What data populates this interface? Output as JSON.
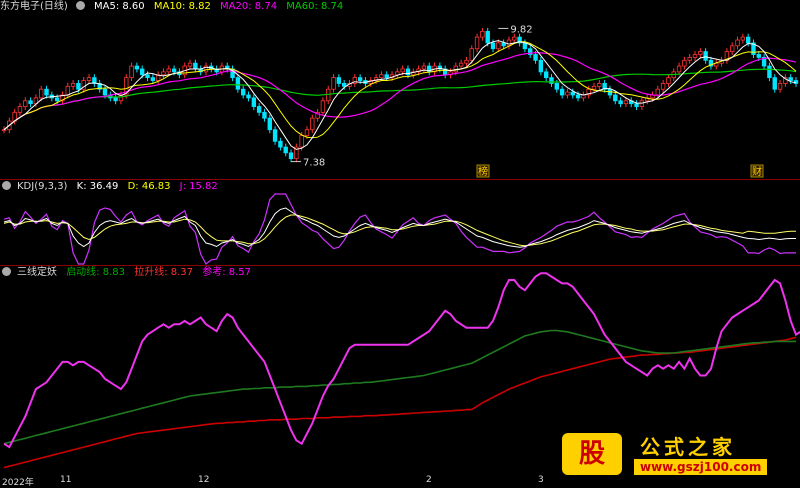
{
  "main": {
    "title": "东方电子(日线)",
    "ma": [
      {
        "label": "MA5: 8.60",
        "color": "#ffffff"
      },
      {
        "label": "MA10: 8.82",
        "color": "#ffff00"
      },
      {
        "label": "MA20: 8.74",
        "color": "#ff00ff"
      },
      {
        "label": "MA60: 8.74",
        "color": "#00cc00"
      }
    ],
    "high_label": "9.82",
    "low_label": "7.38",
    "marker_left": "榜",
    "marker_right": "财"
  },
  "kdj": {
    "title": "KDJ(9,3,3)",
    "items": [
      {
        "label": "K: 36.49",
        "color": "#ffffff"
      },
      {
        "label": "D: 46.83",
        "color": "#ffff00"
      },
      {
        "label": "J: 15.82",
        "color": "#ff00ff"
      }
    ]
  },
  "sanxian": {
    "title": "三线定妖",
    "items": [
      {
        "label": "启动线: 8.83",
        "color": "#00aa00"
      },
      {
        "label": "拉升线: 8.37",
        "color": "#ff3333"
      },
      {
        "label": "参考: 8.57",
        "color": "#ff00ff"
      }
    ]
  },
  "xaxis": {
    "labels": [
      "2022年",
      "11",
      "12",
      "2",
      "3"
    ]
  },
  "watermark": {
    "logo": "股",
    "title": "公式之家",
    "url": "www.gszj100.com"
  },
  "chart_data": {
    "type": "line",
    "n_bars": 150,
    "price": {
      "ylim": [
        7.2,
        10.0
      ],
      "close": [
        8.0,
        8.15,
        8.3,
        8.4,
        8.5,
        8.45,
        8.55,
        8.7,
        8.6,
        8.55,
        8.5,
        8.6,
        8.75,
        8.8,
        8.7,
        8.85,
        8.9,
        8.8,
        8.7,
        8.6,
        8.55,
        8.5,
        8.6,
        8.9,
        9.1,
        9.05,
        8.95,
        8.9,
        8.85,
        8.95,
        9.0,
        9.05,
        9.0,
        8.95,
        9.1,
        9.15,
        9.05,
        9.0,
        9.1,
        9.05,
        9.0,
        9.1,
        9.05,
        8.9,
        8.7,
        8.6,
        8.55,
        8.4,
        8.3,
        8.2,
        8.0,
        7.8,
        7.7,
        7.6,
        7.5,
        7.7,
        7.9,
        8.0,
        8.2,
        8.3,
        8.5,
        8.7,
        8.9,
        8.8,
        8.75,
        8.8,
        8.9,
        8.85,
        8.8,
        8.85,
        8.9,
        8.95,
        8.9,
        8.95,
        9.0,
        9.05,
        8.95,
        9.0,
        9.05,
        9.1,
        9.0,
        9.1,
        9.05,
        8.95,
        9.0,
        9.1,
        9.15,
        9.2,
        9.4,
        9.6,
        9.7,
        9.5,
        9.4,
        9.5,
        9.45,
        9.55,
        9.6,
        9.5,
        9.4,
        9.3,
        9.2,
        9.0,
        8.9,
        8.8,
        8.7,
        8.6,
        8.65,
        8.6,
        8.55,
        8.6,
        8.7,
        8.75,
        8.8,
        8.7,
        8.6,
        8.5,
        8.45,
        8.5,
        8.45,
        8.4,
        8.5,
        8.55,
        8.6,
        8.7,
        8.8,
        8.9,
        9.0,
        9.1,
        9.2,
        9.25,
        9.3,
        9.35,
        9.2,
        9.1,
        9.15,
        9.2,
        9.35,
        9.45,
        9.55,
        9.6,
        9.5,
        9.3,
        9.25,
        9.1,
        8.9,
        8.7,
        8.8,
        8.9,
        8.85,
        8.8
      ],
      "ma_note": "MA lines computed from closes",
      "high": {
        "index": 93,
        "value": 9.82
      },
      "low": {
        "index": 54,
        "value": 7.38
      }
    },
    "kdj": {
      "ylim": [
        0,
        100
      ],
      "K": [
        60,
        62,
        55,
        58,
        65,
        63,
        60,
        62,
        65,
        58,
        55,
        60,
        58,
        40,
        30,
        25,
        30,
        45,
        55,
        60,
        62,
        60,
        58,
        62,
        65,
        60,
        58,
        60,
        62,
        64,
        60,
        58,
        62,
        65,
        68,
        60,
        55,
        40,
        30,
        28,
        25,
        30,
        32,
        35,
        30,
        28,
        25,
        30,
        35,
        45,
        60,
        72,
        78,
        80,
        75,
        70,
        65,
        62,
        58,
        55,
        50,
        45,
        40,
        38,
        40,
        45,
        50,
        55,
        58,
        55,
        52,
        50,
        48,
        45,
        48,
        52,
        55,
        58,
        56,
        55,
        58,
        60,
        62,
        64,
        62,
        60,
        55,
        50,
        45,
        40,
        38,
        35,
        32,
        30,
        28,
        26,
        25,
        24,
        25,
        28,
        30,
        32,
        35,
        38,
        42,
        45,
        48,
        50,
        52,
        55,
        58,
        62,
        60,
        58,
        55,
        52,
        50,
        48,
        46,
        45,
        44,
        46,
        48,
        50,
        52,
        55,
        58,
        60,
        62,
        58,
        55,
        52,
        50,
        48,
        46,
        45,
        44,
        42,
        40,
        38,
        36.49,
        36,
        35,
        36,
        37,
        36,
        35,
        36,
        36.49,
        36.49
      ],
      "D": [
        58,
        60,
        57,
        57,
        60,
        61,
        61,
        61,
        62,
        60,
        58,
        59,
        58,
        52,
        45,
        38,
        35,
        38,
        44,
        50,
        54,
        56,
        57,
        58,
        60,
        60,
        59,
        59,
        60,
        61,
        61,
        60,
        60,
        62,
        64,
        63,
        60,
        53,
        45,
        39,
        34,
        33,
        33,
        33,
        32,
        31,
        29,
        29,
        31,
        36,
        44,
        53,
        61,
        67,
        70,
        70,
        68,
        66,
        63,
        60,
        57,
        53,
        49,
        45,
        43,
        44,
        46,
        49,
        52,
        53,
        53,
        52,
        51,
        49,
        49,
        50,
        52,
        54,
        55,
        55,
        56,
        57,
        59,
        61,
        61,
        61,
        59,
        56,
        52,
        48,
        45,
        42,
        39,
        36,
        33,
        31,
        29,
        27,
        26,
        27,
        28,
        29,
        31,
        33,
        36,
        39,
        42,
        45,
        47,
        50,
        53,
        56,
        57,
        57,
        56,
        55,
        53,
        51,
        50,
        48,
        47,
        47,
        47,
        48,
        49,
        51,
        53,
        55,
        57,
        57,
        56,
        55,
        53,
        51,
        50,
        48,
        47,
        46,
        45,
        44,
        46.83,
        46,
        45,
        44,
        44,
        44,
        45,
        46,
        46.83,
        46.83
      ],
      "J": [
        64,
        66,
        51,
        60,
        75,
        67,
        58,
        64,
        71,
        54,
        49,
        62,
        58,
        16,
        0,
        0,
        20,
        59,
        77,
        80,
        78,
        68,
        60,
        70,
        75,
        60,
        56,
        62,
        66,
        70,
        58,
        54,
        66,
        71,
        76,
        54,
        45,
        14,
        0,
        6,
        7,
        24,
        30,
        39,
        26,
        22,
        17,
        32,
        43,
        63,
        92,
        100,
        100,
        100,
        85,
        70,
        59,
        54,
        48,
        45,
        36,
        29,
        22,
        24,
        34,
        47,
        58,
        67,
        70,
        59,
        50,
        46,
        42,
        37,
        46,
        56,
        61,
        66,
        58,
        55,
        62,
        66,
        68,
        70,
        64,
        58,
        47,
        38,
        31,
        24,
        24,
        21,
        18,
        18,
        18,
        16,
        17,
        18,
        23,
        30,
        34,
        38,
        43,
        48,
        54,
        57,
        60,
        60,
        62,
        65,
        68,
        74,
        66,
        60,
        53,
        46,
        44,
        42,
        38,
        39,
        38,
        44,
        50,
        54,
        58,
        63,
        68,
        70,
        72,
        60,
        53,
        46,
        44,
        42,
        38,
        39,
        38,
        34,
        30,
        26,
        15.82,
        16,
        15,
        20,
        23,
        20,
        15,
        16,
        15.82,
        15.82
      ]
    },
    "sanxian": {
      "ylim": [
        7.2,
        10.0
      ],
      "qidong": [
        7.6,
        7.62,
        7.64,
        7.66,
        7.68,
        7.7,
        7.72,
        7.74,
        7.76,
        7.78,
        7.8,
        7.82,
        7.84,
        7.86,
        7.88,
        7.9,
        7.92,
        7.94,
        7.96,
        7.98,
        8.0,
        8.02,
        8.04,
        8.06,
        8.08,
        8.1,
        8.12,
        8.14,
        8.16,
        8.18,
        8.2,
        8.22,
        8.24,
        8.26,
        8.28,
        8.3,
        8.31,
        8.32,
        8.33,
        8.34,
        8.35,
        8.36,
        8.37,
        8.38,
        8.39,
        8.4,
        8.4,
        8.41,
        8.41,
        8.42,
        8.42,
        8.42,
        8.43,
        8.43,
        8.43,
        8.44,
        8.44,
        8.44,
        8.45,
        8.45,
        8.46,
        8.46,
        8.47,
        8.47,
        8.48,
        8.48,
        8.49,
        8.49,
        8.5,
        8.5,
        8.51,
        8.52,
        8.53,
        8.54,
        8.55,
        8.56,
        8.57,
        8.58,
        8.59,
        8.6,
        8.62,
        8.64,
        8.66,
        8.68,
        8.7,
        8.72,
        8.74,
        8.76,
        8.78,
        8.82,
        8.86,
        8.9,
        8.94,
        8.98,
        9.02,
        9.06,
        9.1,
        9.14,
        9.18,
        9.2,
        9.22,
        9.24,
        9.25,
        9.26,
        9.26,
        9.25,
        9.24,
        9.22,
        9.2,
        9.18,
        9.16,
        9.14,
        9.12,
        9.1,
        9.08,
        9.06,
        9.04,
        9.02,
        9.0,
        8.98,
        8.96,
        8.95,
        8.94,
        8.93,
        8.93,
        8.93,
        8.93,
        8.94,
        8.95,
        8.96,
        8.97,
        8.98,
        8.99,
        9.0,
        9.01,
        9.02,
        9.03,
        9.04,
        9.05,
        9.06,
        9.07,
        9.08,
        9.08,
        9.09,
        9.09,
        9.1,
        9.1,
        9.1,
        9.1,
        9.1
      ],
      "lasheng": [
        7.25,
        7.27,
        7.29,
        7.31,
        7.33,
        7.35,
        7.37,
        7.39,
        7.41,
        7.43,
        7.45,
        7.47,
        7.49,
        7.51,
        7.53,
        7.55,
        7.57,
        7.59,
        7.61,
        7.63,
        7.65,
        7.67,
        7.69,
        7.71,
        7.73,
        7.75,
        7.76,
        7.77,
        7.78,
        7.79,
        7.8,
        7.81,
        7.82,
        7.83,
        7.84,
        7.85,
        7.86,
        7.87,
        7.88,
        7.89,
        7.9,
        7.9,
        7.91,
        7.91,
        7.92,
        7.92,
        7.93,
        7.93,
        7.94,
        7.94,
        7.95,
        7.95,
        7.95,
        7.96,
        7.96,
        7.96,
        7.97,
        7.97,
        7.97,
        7.98,
        7.98,
        7.98,
        7.99,
        7.99,
        7.99,
        8.0,
        8.0,
        8.0,
        8.01,
        8.01,
        8.01,
        8.02,
        8.02,
        8.03,
        8.03,
        8.04,
        8.04,
        8.05,
        8.05,
        8.06,
        8.06,
        8.07,
        8.07,
        8.08,
        8.08,
        8.09,
        8.09,
        8.1,
        8.1,
        8.15,
        8.2,
        8.24,
        8.28,
        8.32,
        8.36,
        8.4,
        8.43,
        8.46,
        8.49,
        8.52,
        8.55,
        8.58,
        8.6,
        8.62,
        8.64,
        8.66,
        8.68,
        8.7,
        8.72,
        8.74,
        8.76,
        8.78,
        8.8,
        8.82,
        8.84,
        8.85,
        8.86,
        8.87,
        8.88,
        8.89,
        8.9,
        8.9,
        8.91,
        8.91,
        8.92,
        8.92,
        8.93,
        8.93,
        8.94,
        8.94,
        8.95,
        8.96,
        8.97,
        8.98,
        8.99,
        9.0,
        9.01,
        9.02,
        9.03,
        9.04,
        9.05,
        9.06,
        9.07,
        9.08,
        9.09,
        9.1,
        9.11,
        9.12,
        9.14,
        9.16
      ],
      "cankao": [
        7.6,
        7.55,
        7.7,
        7.85,
        8.0,
        8.2,
        8.4,
        8.45,
        8.5,
        8.6,
        8.7,
        8.8,
        8.8,
        8.75,
        8.8,
        8.8,
        8.75,
        8.7,
        8.65,
        8.55,
        8.5,
        8.45,
        8.4,
        8.5,
        8.7,
        8.9,
        9.1,
        9.2,
        9.25,
        9.3,
        9.35,
        9.3,
        9.35,
        9.35,
        9.4,
        9.35,
        9.4,
        9.45,
        9.35,
        9.3,
        9.25,
        9.4,
        9.5,
        9.45,
        9.3,
        9.2,
        9.1,
        9.0,
        8.9,
        8.8,
        8.6,
        8.4,
        8.2,
        8.0,
        7.8,
        7.65,
        7.6,
        7.75,
        7.9,
        8.1,
        8.3,
        8.45,
        8.55,
        8.7,
        8.85,
        9.0,
        9.05,
        9.05,
        9.05,
        9.05,
        9.05,
        9.05,
        9.05,
        9.05,
        9.05,
        9.05,
        9.05,
        9.1,
        9.15,
        9.2,
        9.25,
        9.35,
        9.45,
        9.55,
        9.5,
        9.4,
        9.35,
        9.3,
        9.3,
        9.3,
        9.3,
        9.3,
        9.4,
        9.6,
        9.85,
        10.0,
        10.0,
        9.9,
        9.85,
        9.95,
        10.05,
        10.1,
        10.1,
        10.05,
        10.0,
        9.95,
        9.95,
        9.9,
        9.8,
        9.7,
        9.6,
        9.5,
        9.35,
        9.2,
        9.1,
        9.0,
        8.9,
        8.8,
        8.75,
        8.7,
        8.65,
        8.6,
        8.7,
        8.75,
        8.7,
        8.75,
        8.7,
        8.8,
        8.7,
        8.85,
        8.7,
        8.6,
        8.6,
        8.7,
        9.0,
        9.25,
        9.35,
        9.45,
        9.5,
        9.55,
        9.6,
        9.65,
        9.7,
        9.8,
        9.9,
        10.0,
        9.95,
        9.7,
        9.4,
        9.2,
        9.25,
        9.15,
        9.1,
        9.05,
        9.1,
        9.1
      ]
    }
  }
}
